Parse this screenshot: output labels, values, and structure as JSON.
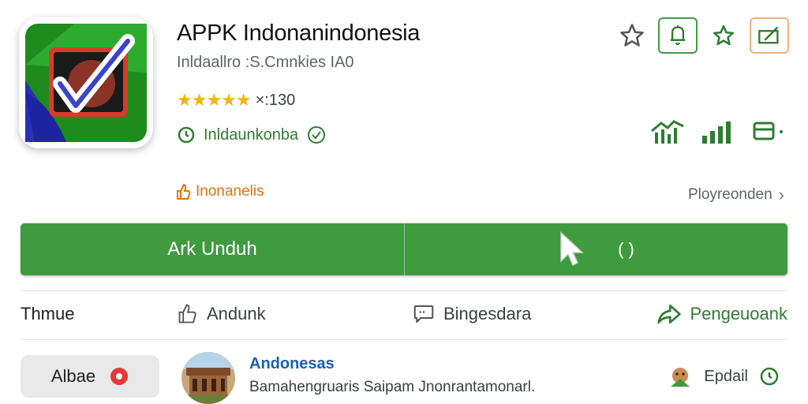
{
  "app": {
    "title": "APPK Indonanindonesia",
    "subtitle": "Inldaallro :S.Cmnkies IA0",
    "rating_value": "×:130",
    "developer": "Inldaunkonba",
    "promo_text": "Inonanelis",
    "side_link": "Ployreonden"
  },
  "install": {
    "label": "Ark Unduh",
    "extra_label": "( )"
  },
  "actions": {
    "theme": "Thmue",
    "like": "Andunk",
    "comment": "Bingesdara",
    "share": "Pengeuoank"
  },
  "review": {
    "chip_label": "Albae",
    "name": "Andonesas",
    "text": "Bamahengruaris Saipam Jnonrantamonarl.",
    "email_label": "Epdail"
  },
  "colors": {
    "accent_green": "#3f9b3f",
    "star_color": "#f4b400",
    "promo_orange": "#e8710a"
  }
}
